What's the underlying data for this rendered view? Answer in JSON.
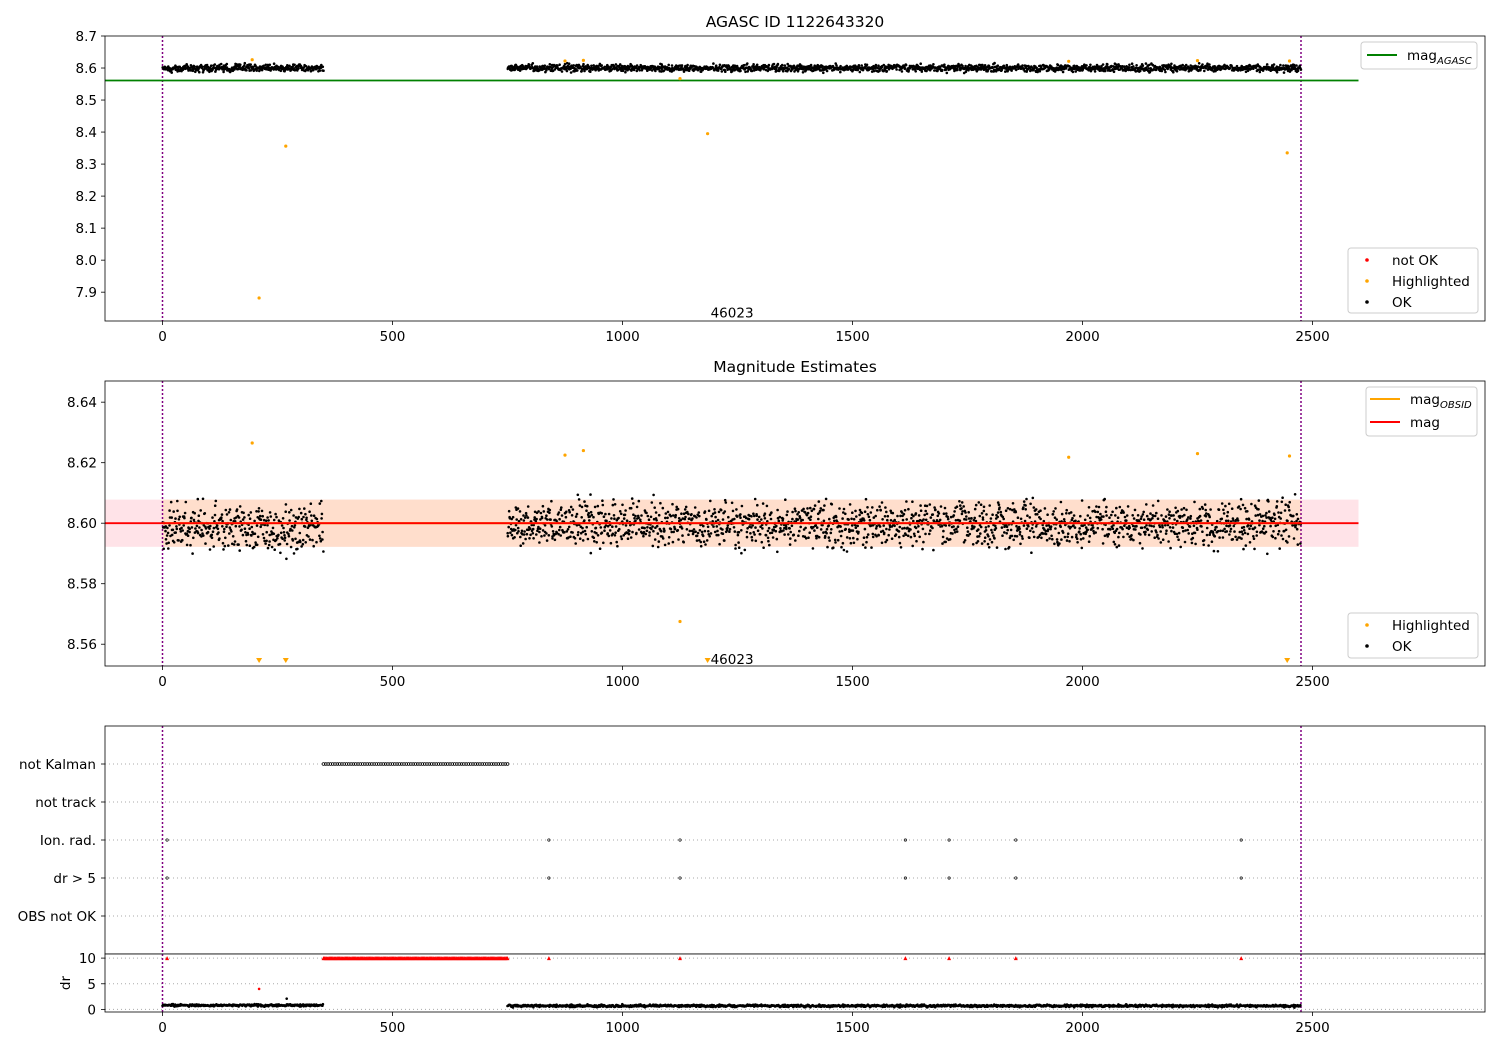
{
  "colors": {
    "ok": "#000000",
    "highlighted": "#ffa500",
    "not_ok": "#ff0000",
    "mag_agasc": "#008000",
    "mag": "#ff0000",
    "mag_obsid": "#ffa500",
    "band_fill": "#ffc0cb",
    "band_fill_obsid": "#ffdab9",
    "vline": "#800080"
  },
  "chart_data": [
    {
      "type": "scatter",
      "title": "AGASC ID 1122643320",
      "xlim": [
        -125,
        2875
      ],
      "ylim": [
        7.81,
        8.7
      ],
      "xticks": [
        "0",
        "500",
        "1000",
        "1500",
        "2000",
        "2500"
      ],
      "yticks": [
        "8.7",
        "8.6",
        "8.5",
        "8.4",
        "8.3",
        "8.2",
        "8.1",
        "8.0",
        "7.9"
      ],
      "vertical_lines_x": [
        0,
        2475
      ],
      "annotation": {
        "text": "46023",
        "x": 1185,
        "y": 7.84
      },
      "lines": [
        {
          "name": "mag",
          "subscript": "AGASC",
          "y": 8.561,
          "x_range": [
            -125,
            2600
          ]
        }
      ],
      "legend_lines": [
        {
          "name": "mag",
          "subscript": "AGASC"
        }
      ],
      "legend_points": [
        "not OK",
        "Highlighted",
        "OK"
      ],
      "ok_segments": [
        {
          "x_range": [
            0,
            350
          ],
          "mean": 8.6,
          "spread": 0.012
        },
        {
          "x_range": [
            750,
            2475
          ],
          "mean": 8.6,
          "spread": 0.012
        }
      ],
      "highlighted_points": [
        {
          "x": 195,
          "y": 8.626
        },
        {
          "x": 210,
          "y": 7.882
        },
        {
          "x": 268,
          "y": 8.356
        },
        {
          "x": 875,
          "y": 8.622
        },
        {
          "x": 915,
          "y": 8.624
        },
        {
          "x": 1125,
          "y": 8.567
        },
        {
          "x": 1185,
          "y": 8.395
        },
        {
          "x": 1970,
          "y": 8.621
        },
        {
          "x": 2250,
          "y": 8.623
        },
        {
          "x": 2445,
          "y": 8.335
        },
        {
          "x": 2450,
          "y": 8.622
        }
      ]
    },
    {
      "type": "scatter",
      "title": "Magnitude Estimates",
      "xlim": [
        -125,
        2875
      ],
      "ylim": [
        8.5528,
        8.647
      ],
      "xticks": [
        "0",
        "500",
        "1000",
        "1500",
        "2000",
        "2500"
      ],
      "yticks": [
        "8.64",
        "8.62",
        "8.60",
        "8.58",
        "8.56"
      ],
      "vertical_lines_x": [
        0,
        2475
      ],
      "annotation": {
        "text": "46023",
        "x": 1185,
        "y": 8.5555
      },
      "lines": [
        {
          "name": "mag",
          "y": 8.6,
          "x_range": [
            -125,
            2600
          ],
          "band": [
            8.5922,
            8.6078
          ]
        },
        {
          "name": "mag",
          "subscript": "OBSID",
          "y": 8.6,
          "x_range": [
            0,
            2475
          ],
          "band": [
            8.5922,
            8.6078
          ]
        }
      ],
      "legend_lines": [
        {
          "name": "mag",
          "subscript": "OBSID"
        },
        {
          "name": "mag"
        }
      ],
      "legend_points": [
        "Highlighted",
        "OK"
      ],
      "ok_segments": [
        {
          "x_range": [
            0,
            350
          ],
          "mean": 8.5985,
          "spread": 0.008
        },
        {
          "x_range": [
            750,
            2475
          ],
          "mean": 8.5995,
          "spread": 0.0075
        }
      ],
      "highlighted_points": [
        {
          "x": 195,
          "y": 8.6265
        },
        {
          "x": 875,
          "y": 8.6225
        },
        {
          "x": 915,
          "y": 8.624
        },
        {
          "x": 1125,
          "y": 8.5675
        },
        {
          "x": 1970,
          "y": 8.6218
        },
        {
          "x": 2250,
          "y": 8.623
        },
        {
          "x": 2450,
          "y": 8.6222
        }
      ],
      "below_range_markers_x": [
        210,
        268,
        1185,
        2445
      ]
    },
    {
      "type": "scatter",
      "title": "",
      "xlim": [
        -125,
        2875
      ],
      "xticks": [
        "0",
        "500",
        "1000",
        "1500",
        "2000",
        "2500"
      ],
      "vertical_lines_x": [
        0,
        2475
      ],
      "flag_rows": [
        "not Kalman",
        "not track",
        "Ion. rad.",
        "dr > 5",
        "OBS not OK"
      ],
      "flags": {
        "not Kalman": {
          "x_range": [
            350,
            750
          ]
        },
        "not track": {
          "x": []
        },
        "Ion. rad.": {
          "x": [
            10,
            840,
            1125,
            1615,
            1710,
            1855,
            2345
          ]
        },
        "dr > 5": {
          "x": [
            10,
            840,
            1125,
            1615,
            1710,
            1855,
            2345
          ]
        },
        "OBS not OK": {
          "x": []
        }
      },
      "dr": {
        "ylabel": "dr",
        "ylim": [
          -0.5,
          10.8
        ],
        "yticks": [
          "10",
          "5",
          "0"
        ],
        "ok_segments": [
          {
            "x_range": [
              0,
              350
            ],
            "mean": 0.8,
            "spread": 0.3
          },
          {
            "x_range": [
              750,
              2475
            ],
            "mean": 0.7,
            "spread": 0.35
          }
        ],
        "clipped_x_range": [
          350,
          750
        ],
        "clipped_points_x": [
          10,
          840,
          1125,
          1615,
          1710,
          1855,
          2345
        ],
        "other_points": [
          {
            "x": 210,
            "y": 4.0
          },
          {
            "x": 270,
            "y": 2.1
          }
        ]
      }
    }
  ]
}
